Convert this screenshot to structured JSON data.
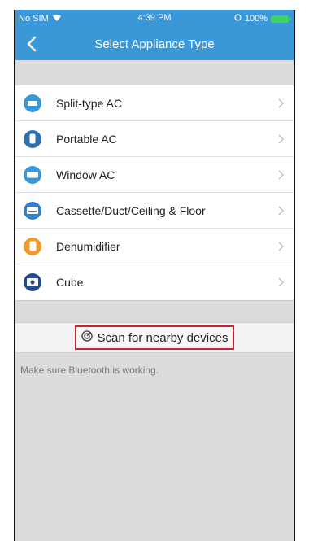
{
  "status": {
    "carrier": "No SIM",
    "time": "4:39 PM",
    "battery": "100%"
  },
  "nav": {
    "title": "Select Appliance Type"
  },
  "appliances": [
    {
      "label": "Split-type AC",
      "icon": "split-ac-icon",
      "color": "#3a97d8"
    },
    {
      "label": "Portable AC",
      "icon": "portable-ac-icon",
      "color": "#2f6fb0"
    },
    {
      "label": "Window AC",
      "icon": "window-ac-icon",
      "color": "#3a97d8"
    },
    {
      "label": "Cassette/Duct/Ceiling & Floor",
      "icon": "cassette-icon",
      "color": "#2f7fc8"
    },
    {
      "label": "Dehumidifier",
      "icon": "dehumidifier-icon",
      "color": "#f29a2e"
    },
    {
      "label": "Cube",
      "icon": "cube-icon",
      "color": "#1f4a8f"
    }
  ],
  "scan": {
    "label": "Scan for nearby devices",
    "highlight_color": "#c8232c"
  },
  "hint": "Make sure Bluetooth is working."
}
